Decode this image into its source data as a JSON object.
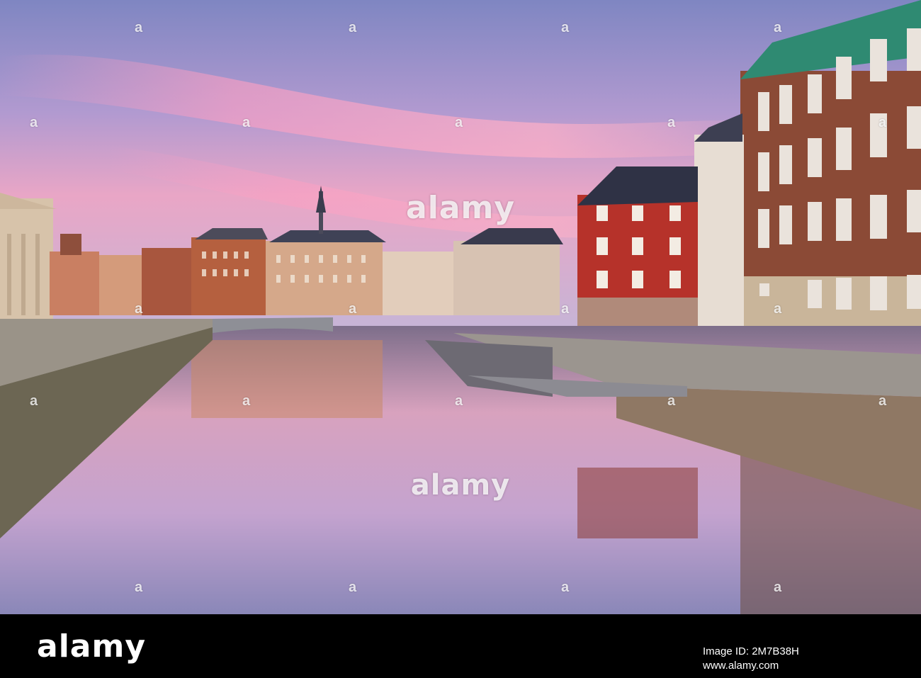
{
  "photo": {
    "subject": "canal-cityscape",
    "colors": {
      "sky_top": "#8a8fc9",
      "sky_pink": "#f0a4c3",
      "water": "#b79bbf",
      "brick": "#8b4a36",
      "red_house": "#b6322a",
      "copper_roof": "#2f8a72"
    }
  },
  "watermark": {
    "tile_text": "a",
    "top_text": "alamy",
    "mid_text": "alamy"
  },
  "footer": {
    "logo": "alamy",
    "image_id": "Image ID: 2M7B38H",
    "url": "www.alamy.com"
  }
}
